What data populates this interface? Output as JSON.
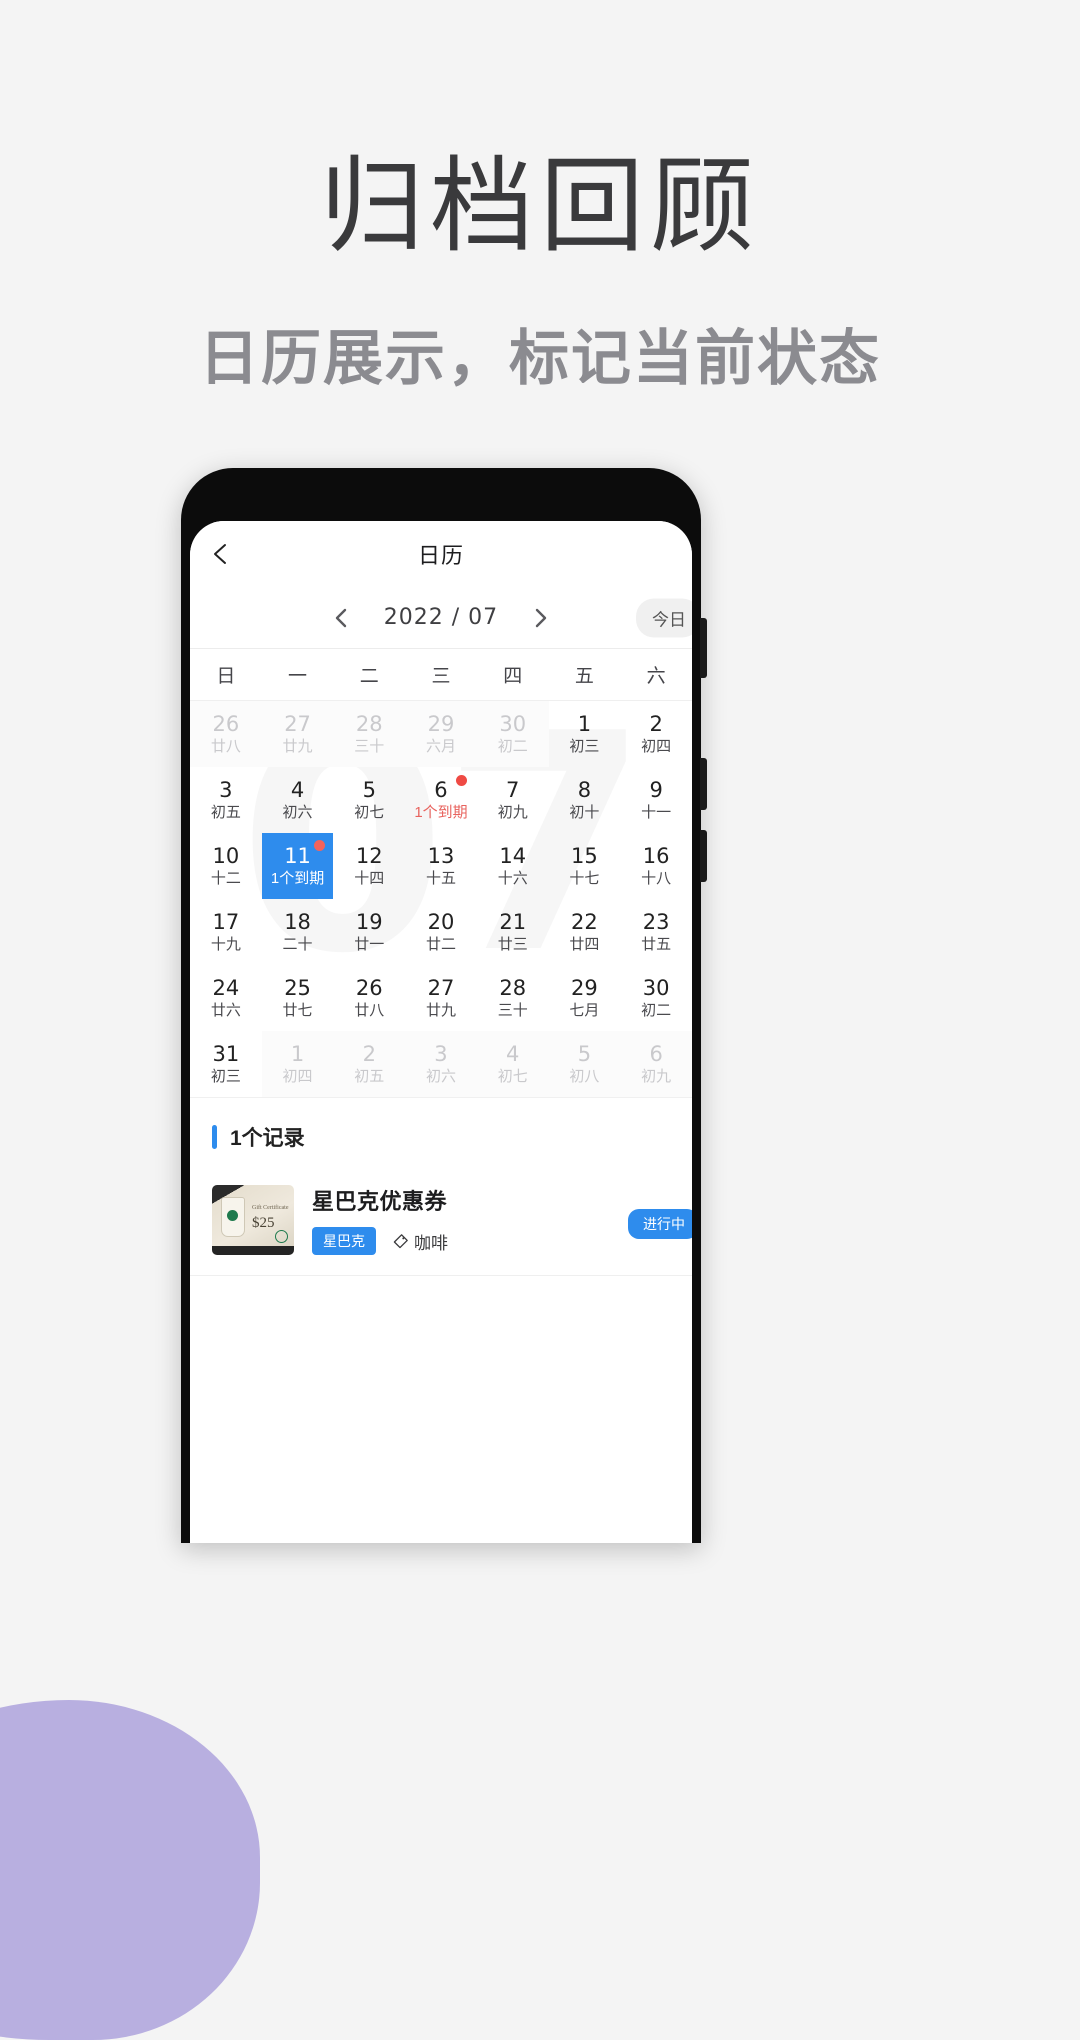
{
  "page": {
    "main_title": "归档回顾",
    "sub_title": "日历展示，标记当前状态"
  },
  "colors": {
    "accent_blue": "#2e8ced",
    "due_red": "#e8635e",
    "dot_red": "#ef4a44",
    "page_bg": "#f4f4f4",
    "blob_purple": "#b8afe0",
    "title_gray": "#3a3a3c",
    "subtitle_gray": "#8b8b90"
  },
  "app": {
    "header": {
      "back_icon": "chevron-left-icon",
      "title": "日历"
    },
    "month_nav": {
      "prev_icon": "chevron-left-icon",
      "next_icon": "chevron-right-icon",
      "label": "2022 / 07",
      "today_label": "今日"
    },
    "weekdays": [
      "日",
      "一",
      "二",
      "三",
      "四",
      "五",
      "六"
    ],
    "watermark": "07",
    "calendar": {
      "weeks": [
        [
          {
            "num": "26",
            "sub": "廿八",
            "out": true
          },
          {
            "num": "27",
            "sub": "廿九",
            "out": true
          },
          {
            "num": "28",
            "sub": "三十",
            "out": true
          },
          {
            "num": "29",
            "sub": "六月",
            "out": true
          },
          {
            "num": "30",
            "sub": "初二",
            "out": true
          },
          {
            "num": "1",
            "sub": "初三"
          },
          {
            "num": "2",
            "sub": "初四"
          }
        ],
        [
          {
            "num": "3",
            "sub": "初五"
          },
          {
            "num": "4",
            "sub": "初六"
          },
          {
            "num": "5",
            "sub": "初七"
          },
          {
            "num": "6",
            "sub": "1个到期",
            "due": true,
            "dot": true
          },
          {
            "num": "7",
            "sub": "初九"
          },
          {
            "num": "8",
            "sub": "初十"
          },
          {
            "num": "9",
            "sub": "十一"
          }
        ],
        [
          {
            "num": "10",
            "sub": "十二"
          },
          {
            "num": "11",
            "sub": "1个到期",
            "selected": true,
            "dot": true
          },
          {
            "num": "12",
            "sub": "十四"
          },
          {
            "num": "13",
            "sub": "十五"
          },
          {
            "num": "14",
            "sub": "十六"
          },
          {
            "num": "15",
            "sub": "十七"
          },
          {
            "num": "16",
            "sub": "十八"
          }
        ],
        [
          {
            "num": "17",
            "sub": "十九"
          },
          {
            "num": "18",
            "sub": "二十"
          },
          {
            "num": "19",
            "sub": "廿一"
          },
          {
            "num": "20",
            "sub": "廿二"
          },
          {
            "num": "21",
            "sub": "廿三"
          },
          {
            "num": "22",
            "sub": "廿四"
          },
          {
            "num": "23",
            "sub": "廿五"
          }
        ],
        [
          {
            "num": "24",
            "sub": "廿六"
          },
          {
            "num": "25",
            "sub": "廿七"
          },
          {
            "num": "26",
            "sub": "廿八"
          },
          {
            "num": "27",
            "sub": "廿九"
          },
          {
            "num": "28",
            "sub": "三十"
          },
          {
            "num": "29",
            "sub": "七月"
          },
          {
            "num": "30",
            "sub": "初二"
          }
        ],
        [
          {
            "num": "31",
            "sub": "初三"
          },
          {
            "num": "1",
            "sub": "初四",
            "out": true
          },
          {
            "num": "2",
            "sub": "初五",
            "out": true
          },
          {
            "num": "3",
            "sub": "初六",
            "out": true
          },
          {
            "num": "4",
            "sub": "初七",
            "out": true
          },
          {
            "num": "5",
            "sub": "初八",
            "out": true
          },
          {
            "num": "6",
            "sub": "初九",
            "out": true
          }
        ]
      ]
    },
    "records": {
      "section_title": "1个记录",
      "items": [
        {
          "name": "星巴克优惠券",
          "brand_tag": "星巴克",
          "category_icon": "tag-icon",
          "category": "咖啡",
          "status": "进行中",
          "thumb_gift_text": "Gift Certificate",
          "thumb_amount": "$25"
        }
      ]
    }
  }
}
